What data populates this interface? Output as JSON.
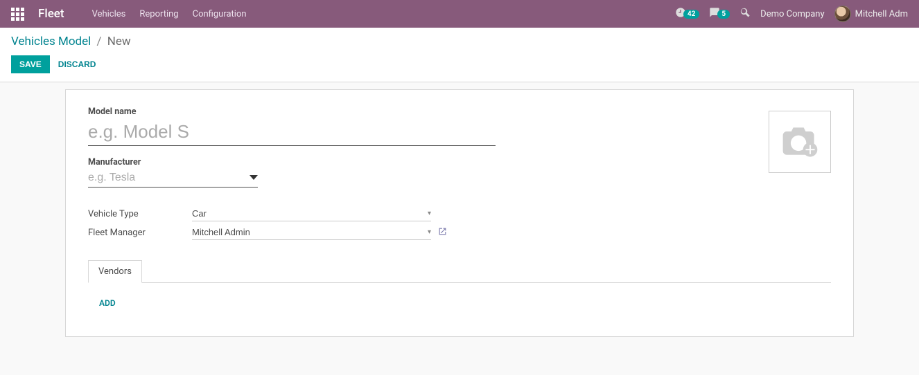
{
  "navbar": {
    "brand": "Fleet",
    "menu": [
      "Vehicles",
      "Reporting",
      "Configuration"
    ],
    "timer_badge": "42",
    "chat_badge": "5",
    "company": "Demo Company",
    "user": "Mitchell Admin",
    "user_short": "Mitchell Adm"
  },
  "breadcrumb": {
    "parent": "Vehicles Model",
    "current": "New"
  },
  "actions": {
    "save": "SAVE",
    "discard": "DISCARD"
  },
  "form": {
    "model_name_label": "Model name",
    "model_name_placeholder": "e.g. Model S",
    "model_name_value": "",
    "manufacturer_label": "Manufacturer",
    "manufacturer_placeholder": "e.g. Tesla",
    "manufacturer_value": "",
    "vehicle_type_label": "Vehicle Type",
    "vehicle_type_value": "Car",
    "fleet_manager_label": "Fleet Manager",
    "fleet_manager_value": "Mitchell Admin"
  },
  "tabs": {
    "vendors": "Vendors",
    "add": "ADD"
  }
}
